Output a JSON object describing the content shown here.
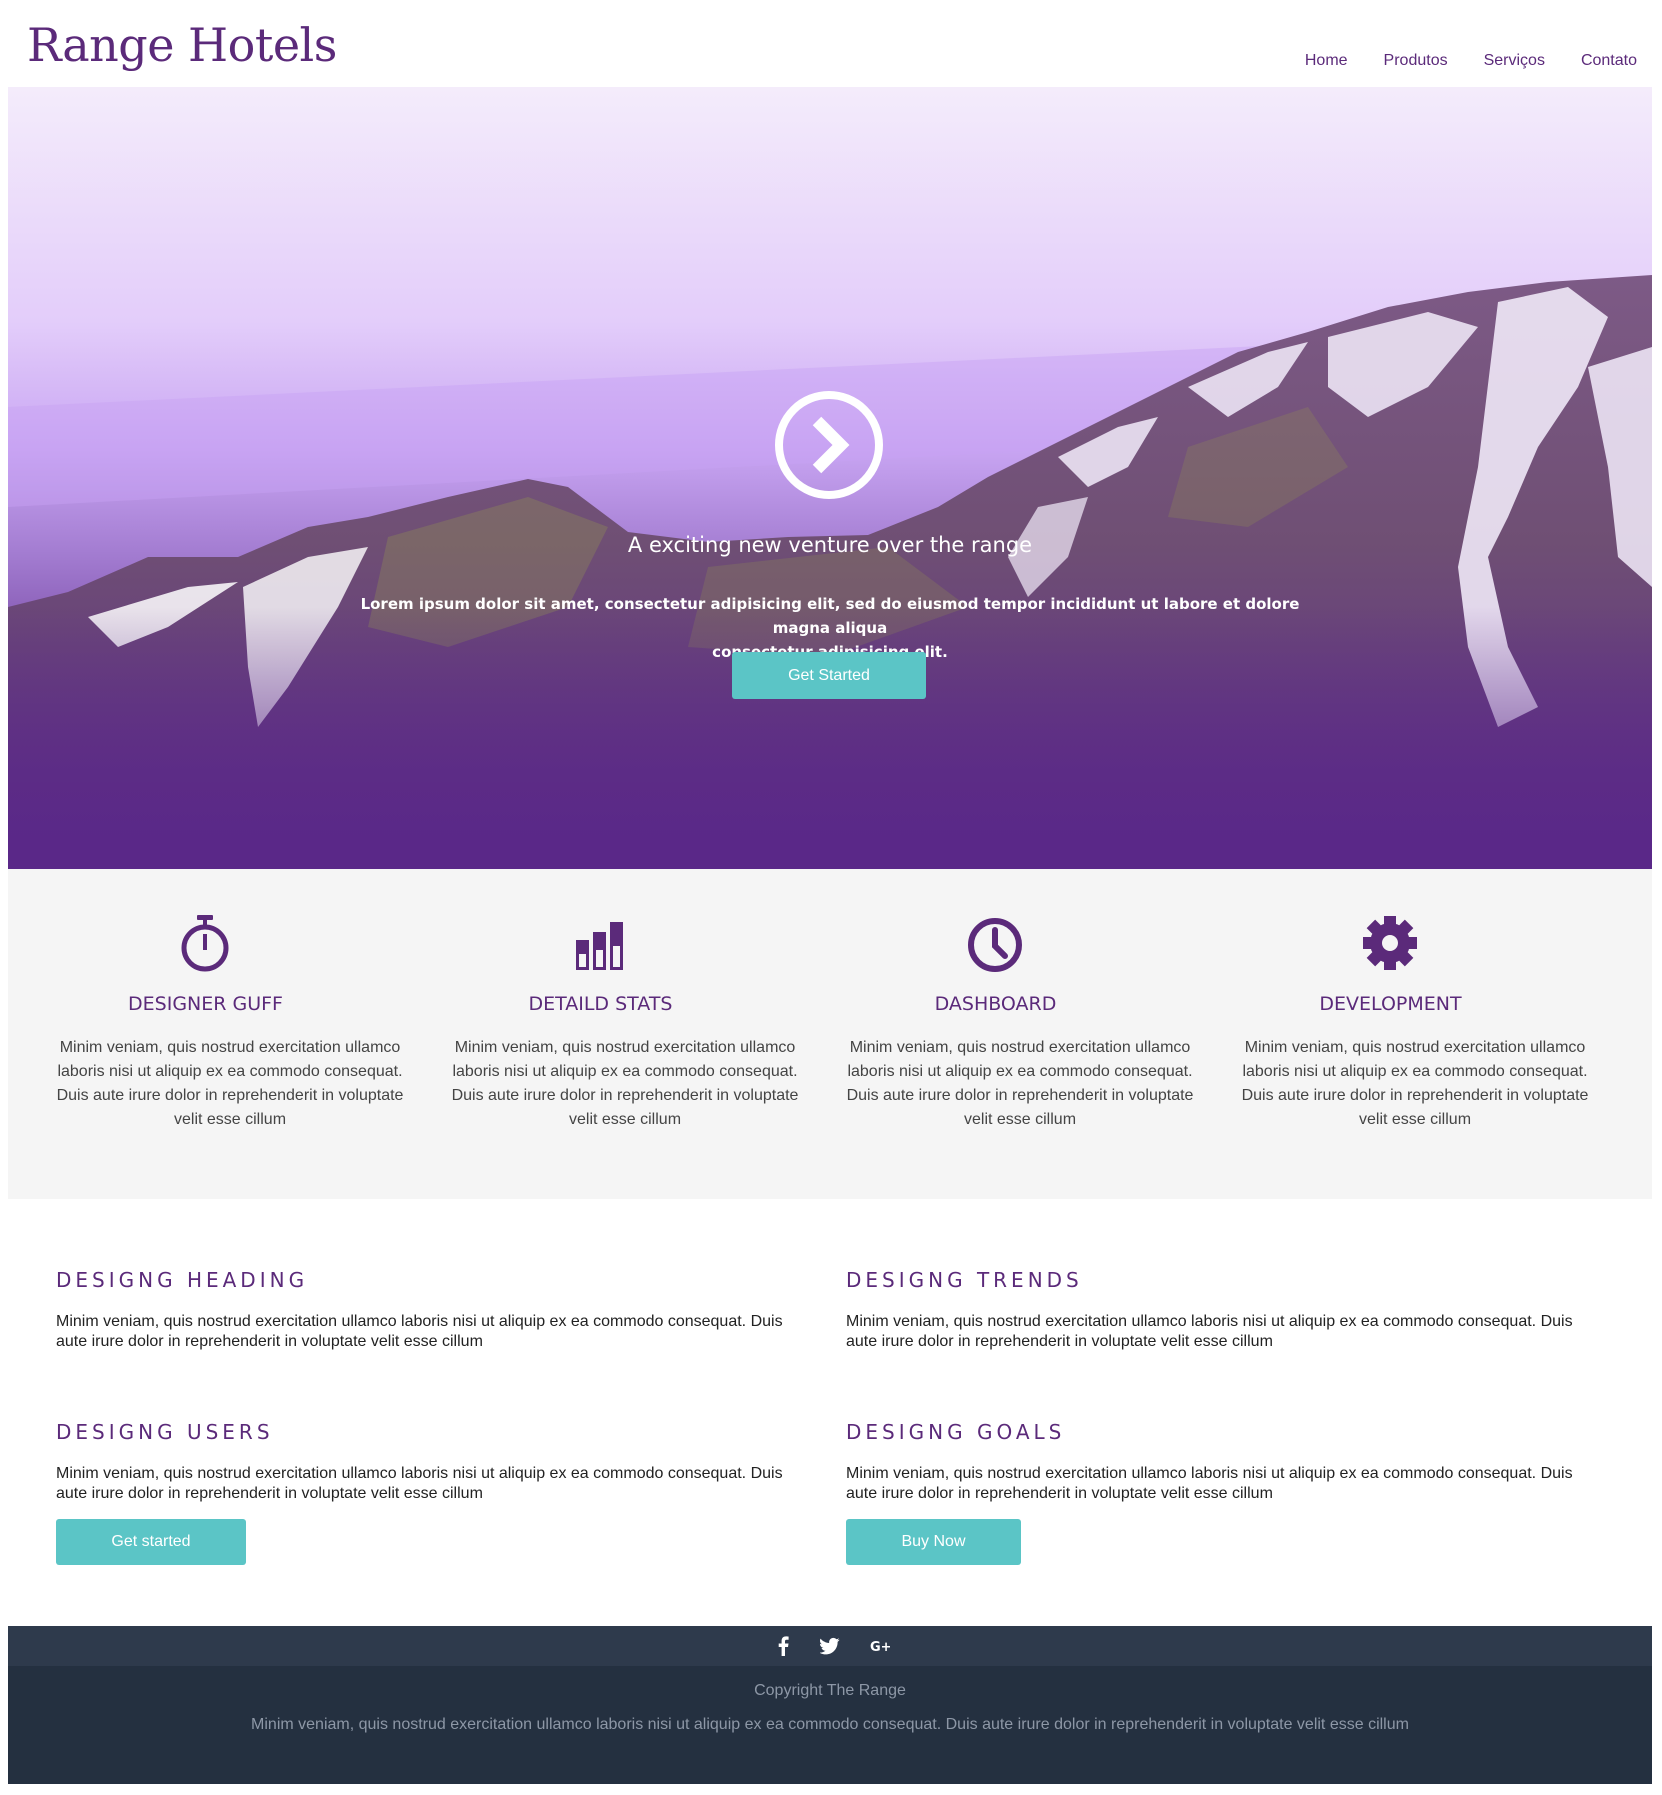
{
  "header": {
    "logo": "Range Hotels",
    "nav": [
      "Home",
      "Produtos",
      "Serviços",
      "Contato"
    ]
  },
  "hero": {
    "play_icon": "chevron-right-circle-icon",
    "title": "A exciting new venture over the range",
    "text_line1": "Lorem ipsum dolor sit amet, consectetur adipisicing elit, sed do eiusmod tempor incididunt ut labore et dolore magna aliqua",
    "text_line2": "consectetur adipisicing elit.",
    "button": "Get Started"
  },
  "features": [
    {
      "icon": "stopwatch-icon",
      "title": "DESIGNER GUFF",
      "text": "Minim veniam, quis nostrud exercitation ullamco laboris nisi ut aliquip ex ea commodo consequat. Duis aute irure dolor in reprehenderit in voluptate velit esse cillum"
    },
    {
      "icon": "bar-chart-icon",
      "title": "DETAILD STATS",
      "text": "Minim veniam, quis nostrud exercitation ullamco laboris nisi ut aliquip ex ea commodo consequat. Duis aute irure dolor in reprehenderit in voluptate velit esse cillum"
    },
    {
      "icon": "clock-icon",
      "title": "DASHBOARD",
      "text": "Minim veniam, quis nostrud exercitation ullamco laboris nisi ut aliquip ex ea commodo consequat. Duis aute irure dolor in reprehenderit in voluptate velit esse cillum"
    },
    {
      "icon": "gear-icon",
      "title": "DEVELOPMENT",
      "text": "Minim veniam, quis nostrud exercitation ullamco laboris nisi ut aliquip ex ea commodo consequat. Duis aute irure dolor in reprehenderit in voluptate velit esse cillum"
    }
  ],
  "blocks": [
    {
      "title": "DESIGNG HEADING",
      "text": "Minim veniam, quis nostrud exercitation ullamco laboris nisi ut aliquip ex ea commodo consequat. Duis aute irure dolor in reprehenderit in voluptate velit esse cillum"
    },
    {
      "title": "DESIGNG TRENDS",
      "text": "Minim veniam, quis nostrud exercitation ullamco laboris nisi ut aliquip ex ea commodo consequat. Duis aute irure dolor in reprehenderit in voluptate velit esse cillum"
    },
    {
      "title": "DESIGNG USERS",
      "text": "Minim veniam, quis nostrud exercitation ullamco laboris nisi ut aliquip ex ea commodo consequat. Duis aute irure dolor in reprehenderit in voluptate velit esse cillum",
      "button": "Get started"
    },
    {
      "title": "DESIGNG GOALS",
      "text": "Minim veniam, quis nostrud exercitation ullamco laboris nisi ut aliquip ex ea commodo consequat. Duis aute irure dolor in reprehenderit in voluptate velit esse cillum",
      "button": "Buy Now"
    }
  ],
  "footer": {
    "social_icons": [
      "facebook-icon",
      "twitter-icon",
      "google-plus-icon"
    ],
    "copyright": "Copyright The Range",
    "text": "Minim veniam, quis nostrud exercitation ullamco laboris nisi ut aliquip ex ea commodo consequat. Duis aute irure dolor in reprehenderit in voluptate velit esse cillum"
  },
  "colors": {
    "brand_purple": "#5b2a7a",
    "accent_teal": "#5bc5c6",
    "features_bg": "#f5f5f5",
    "footer_bar": "#2e3a4c",
    "footer_bg": "#243040"
  }
}
